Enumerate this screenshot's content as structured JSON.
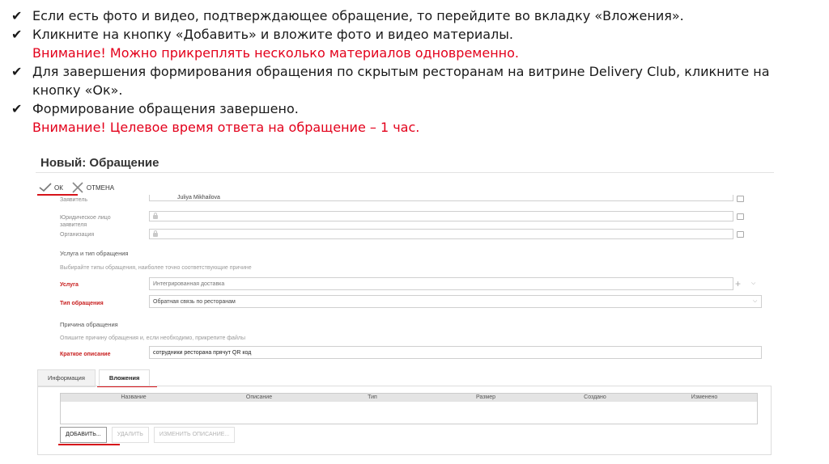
{
  "instructions": {
    "check_mark": "✔",
    "line1": "Если есть фото и видео, подтверждающее обращение, то перейдите во вкладку «Вложения».",
    "line2": "Кликните на кнопку «Добавить» и вложите фото и видео материалы.",
    "warn1": "Внимание! Можно прикреплять несколько материалов одновременно.",
    "line3a": "Для завершения формирования обращения по скрытым ресторанам на витрине Delivery Club, кликните на",
    "line3b": "кнопку «Ок».",
    "line4": "Формирование обращения завершено.",
    "warn2": "Внимание! Целевое время ответа на обращение – 1 час."
  },
  "form": {
    "title": "Новый: Обращение",
    "toolbar": {
      "ok_label": "ОК",
      "cancel_label": "ОТМЕНА"
    },
    "fields": {
      "applicant_label": "Заявитель",
      "applicant_value": "Juliya Mikhailova",
      "legal_label": "Юридическое лицо заявителя",
      "org_label": "Организация",
      "section_service": "Услуга и тип обращения",
      "section_service_hint": "Выбирайте типы обращения, наиболее точно соответствующие причине",
      "service_label": "Услуга",
      "service_value": "Интегрированная доставка",
      "type_label": "Тип обращения",
      "type_value": "Обратная связь по ресторанам",
      "section_reason": "Причина обращения",
      "section_reason_hint": "Опишите причину обращения и, если необходимо, прикрепите файлы",
      "short_desc_label": "Краткое описание",
      "short_desc_value": "сотрудники ресторана прячут  QR код"
    },
    "tabs": [
      {
        "label": "Информация"
      },
      {
        "label": "Вложения"
      }
    ],
    "grid_columns": [
      "Название",
      "Описание",
      "Тип",
      "Размер",
      "Создано",
      "Изменено"
    ],
    "actions": {
      "add": "ДОБАВИТЬ...",
      "delete": "УДАЛИТЬ",
      "edit": "ИЗМЕНИТЬ ОПИСАНИЕ..."
    }
  },
  "colors": {
    "warning": "#e3001b",
    "highlight": "#d7141a"
  }
}
